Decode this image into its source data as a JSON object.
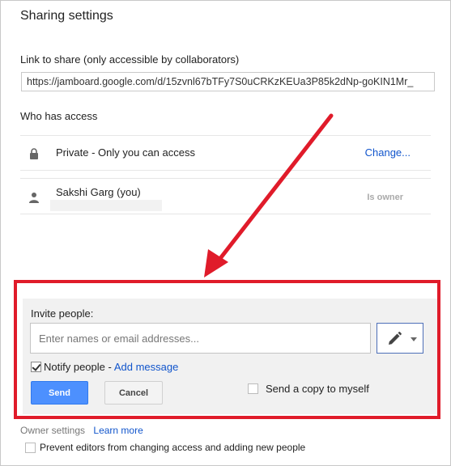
{
  "dialog": {
    "title": "Sharing settings",
    "link_label": "Link to share (only accessible by collaborators)",
    "link_value": "https://jamboard.google.com/d/15zvnl67bTFy7S0uCRKzKEUa3P85k2dNp-goKIN1Mr_",
    "who_has_access_label": "Who has access"
  },
  "access": {
    "private": {
      "icon": "lock-icon",
      "text": "Private - Only you can access",
      "action": "Change..."
    },
    "owner": {
      "icon": "person-icon",
      "name": "Sakshi Garg (you)",
      "role": "Is owner"
    }
  },
  "invite": {
    "label": "Invite people:",
    "placeholder": "Enter names or email addresses...",
    "permission_icon": "pencil-icon",
    "notify_label": "Notify people -",
    "notify_checked": true,
    "add_message": "Add message",
    "send_label": "Send",
    "cancel_label": "Cancel",
    "copy_label": "Send a copy to myself",
    "copy_checked": false
  },
  "owner_settings": {
    "label": "Owner settings",
    "learn_more": "Learn more",
    "prevent_label": "Prevent editors from changing access and adding new people",
    "prevent_checked": false
  },
  "colors": {
    "link_blue": "#1155cc",
    "send_blue": "#4d90fe",
    "annotation_red": "#e01b2a"
  }
}
